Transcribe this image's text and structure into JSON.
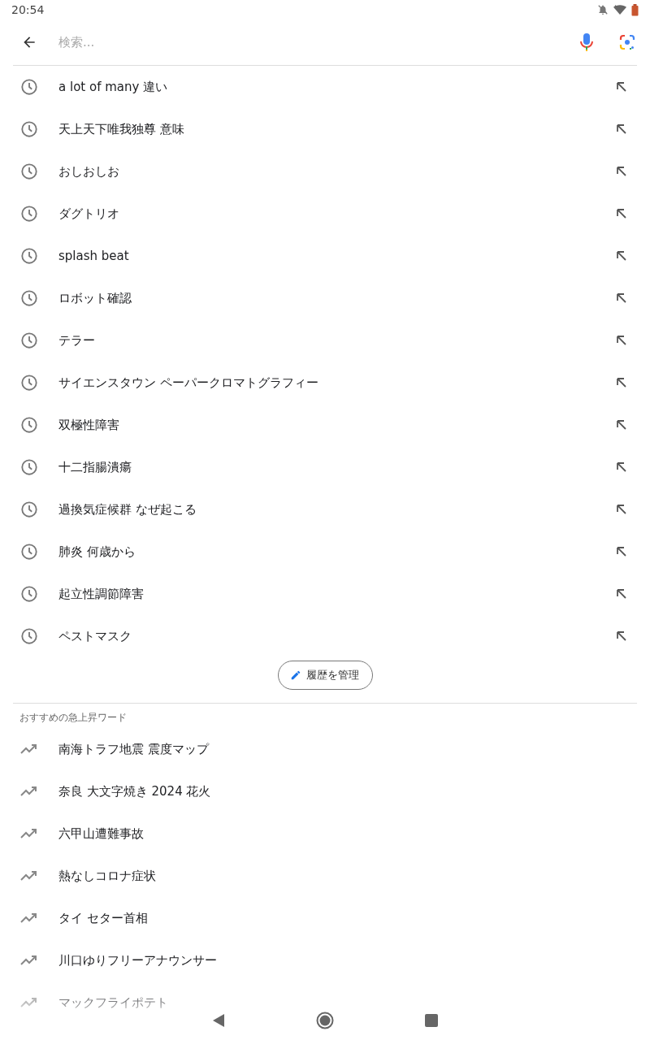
{
  "status_bar": {
    "time": "20:54"
  },
  "search": {
    "placeholder": "検索..."
  },
  "history": [
    {
      "text": "a lot of many 違い"
    },
    {
      "text": "天上天下唯我独尊 意味"
    },
    {
      "text": "おしおしお"
    },
    {
      "text": "ダグトリオ"
    },
    {
      "text": "splash beat"
    },
    {
      "text": "ロボット確認"
    },
    {
      "text": "テラー"
    },
    {
      "text": "サイエンスタウン ペーパークロマトグラフィー"
    },
    {
      "text": "双極性障害"
    },
    {
      "text": "十二指腸潰瘍"
    },
    {
      "text": "過換気症候群 なぜ起こる"
    },
    {
      "text": "肺炎 何歳から"
    },
    {
      "text": "起立性調節障害"
    },
    {
      "text": "ペストマスク"
    }
  ],
  "manage_button": {
    "label": "履歴を管理"
  },
  "trending": {
    "title": "おすすめの急上昇ワード",
    "items": [
      {
        "text": "南海トラフ地震 震度マップ"
      },
      {
        "text": "奈良 大文字焼き 2024 花火"
      },
      {
        "text": "六甲山遭難事故"
      },
      {
        "text": "熱なしコロナ症状"
      },
      {
        "text": "タイ セター首相"
      },
      {
        "text": "川口ゆりフリーアナウンサー"
      },
      {
        "text": "マックフライポテト"
      }
    ]
  }
}
